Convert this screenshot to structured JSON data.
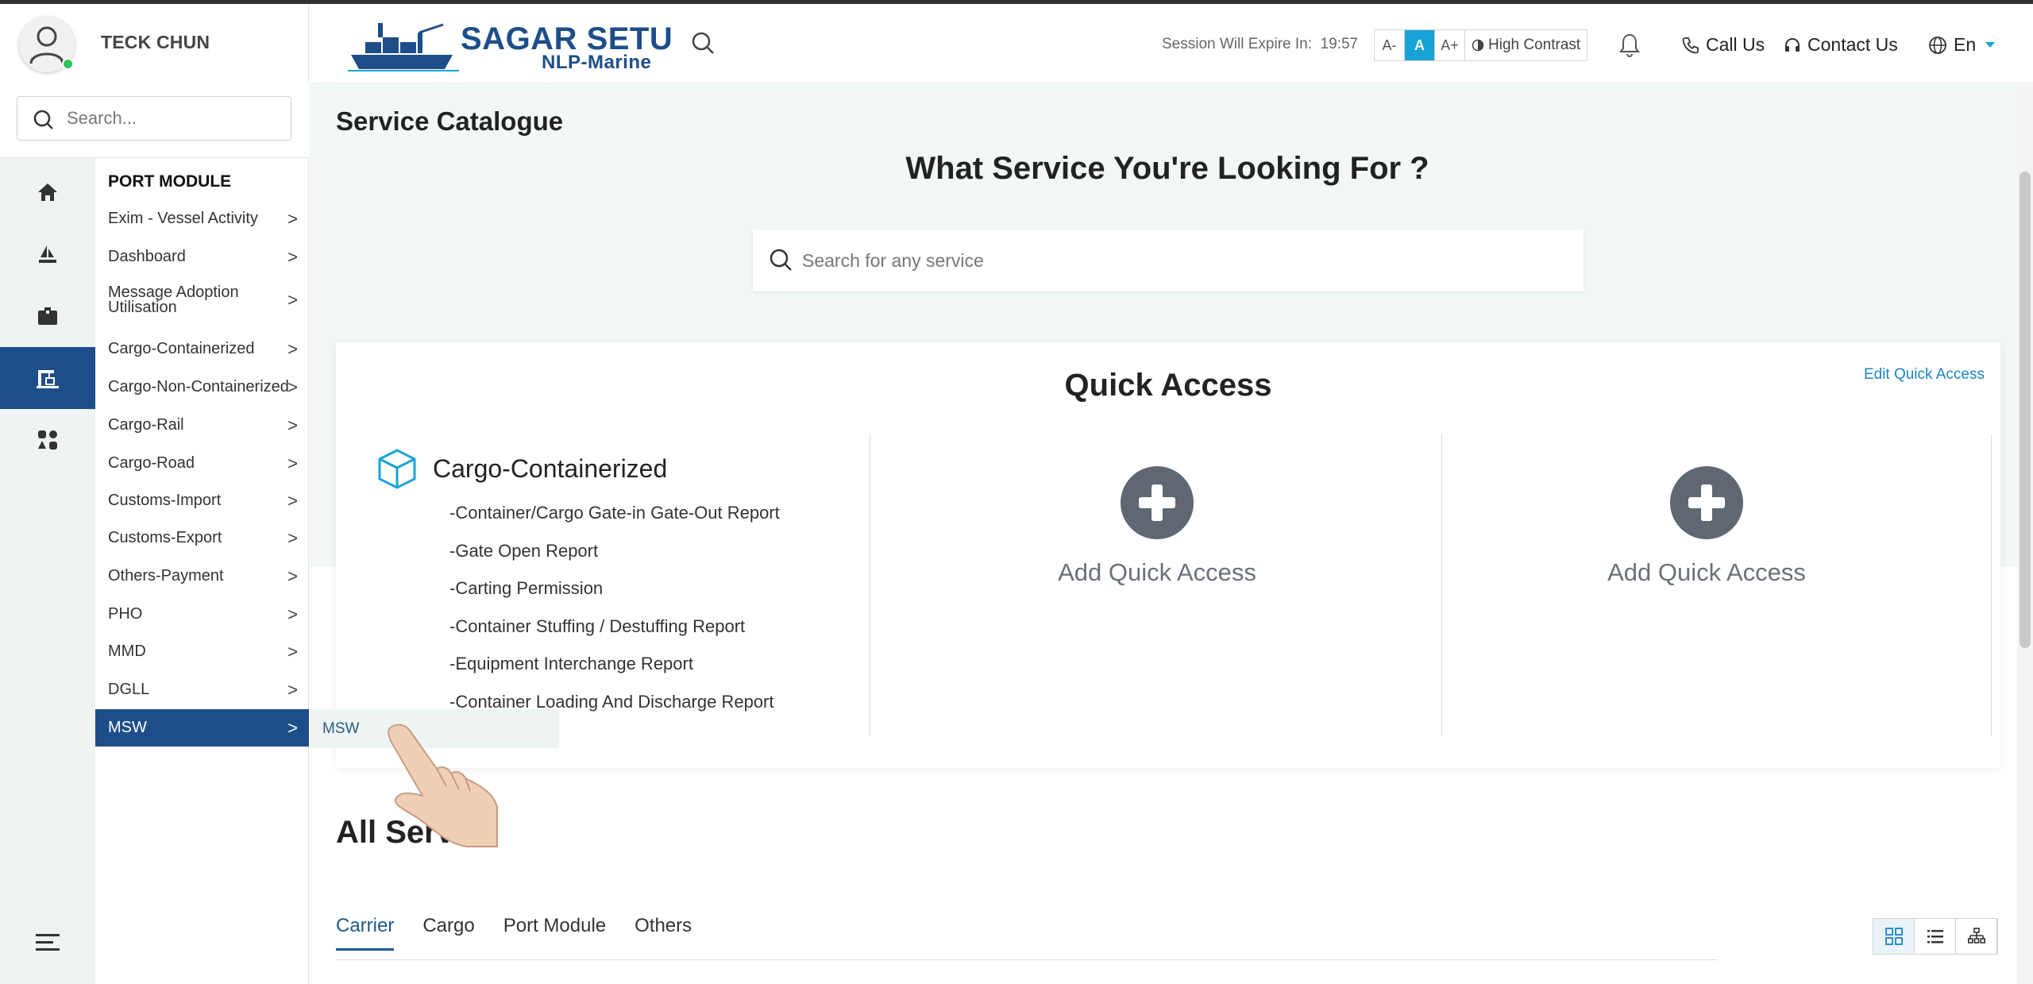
{
  "user": {
    "name": "TECK CHUN"
  },
  "sidebar": {
    "search_placeholder": "Search...",
    "module_title": "PORT MODULE",
    "items": [
      {
        "label": "Exim - Vessel Activity"
      },
      {
        "label": "Dashboard"
      },
      {
        "label": "Message Adoption Utilisation"
      },
      {
        "label": "Cargo-Containerized"
      },
      {
        "label": "Cargo-Non-Containerized"
      },
      {
        "label": "Cargo-Rail"
      },
      {
        "label": "Cargo-Road"
      },
      {
        "label": "Customs-Import"
      },
      {
        "label": "Customs-Export"
      },
      {
        "label": "Others-Payment"
      },
      {
        "label": "PHO"
      },
      {
        "label": "MMD"
      },
      {
        "label": "DGLL"
      },
      {
        "label": "MSW"
      }
    ],
    "flyout_item": "MSW",
    "chevron": ">"
  },
  "header": {
    "logo_title": "SAGAR SETU",
    "logo_subtitle": "NLP-Marine",
    "session_label": "Session Will Expire In:",
    "session_time": "19:57",
    "font_small": "A-",
    "font_normal": "A",
    "font_large": "A+",
    "high_contrast": "High Contrast",
    "call_us": "Call Us",
    "contact_us": "Contact Us",
    "language": "En"
  },
  "main": {
    "page_title": "Service Catalogue",
    "hero_title": "What Service You're Looking For ?",
    "search_placeholder": "Search for any service",
    "quick_access": {
      "title": "Quick Access",
      "edit_label": "Edit Quick Access",
      "category": "Cargo-Containerized",
      "links": [
        "-Container/Cargo Gate-in Gate-Out Report",
        "-Gate Open Report",
        "-Carting Permission",
        "-Container Stuffing / Destuffing Report",
        "-Equipment Interchange Report",
        "-Container Loading And Discharge Report"
      ],
      "add_label_1": "Add Quick Access",
      "add_label_2": "Add Quick Access"
    },
    "all_services_title": "All Service",
    "tabs": [
      "Carrier",
      "Cargo",
      "Port Module",
      "Others"
    ]
  },
  "colors": {
    "brand": "#1d4e89",
    "accent": "#17a2d8",
    "link": "#1d84c6"
  }
}
